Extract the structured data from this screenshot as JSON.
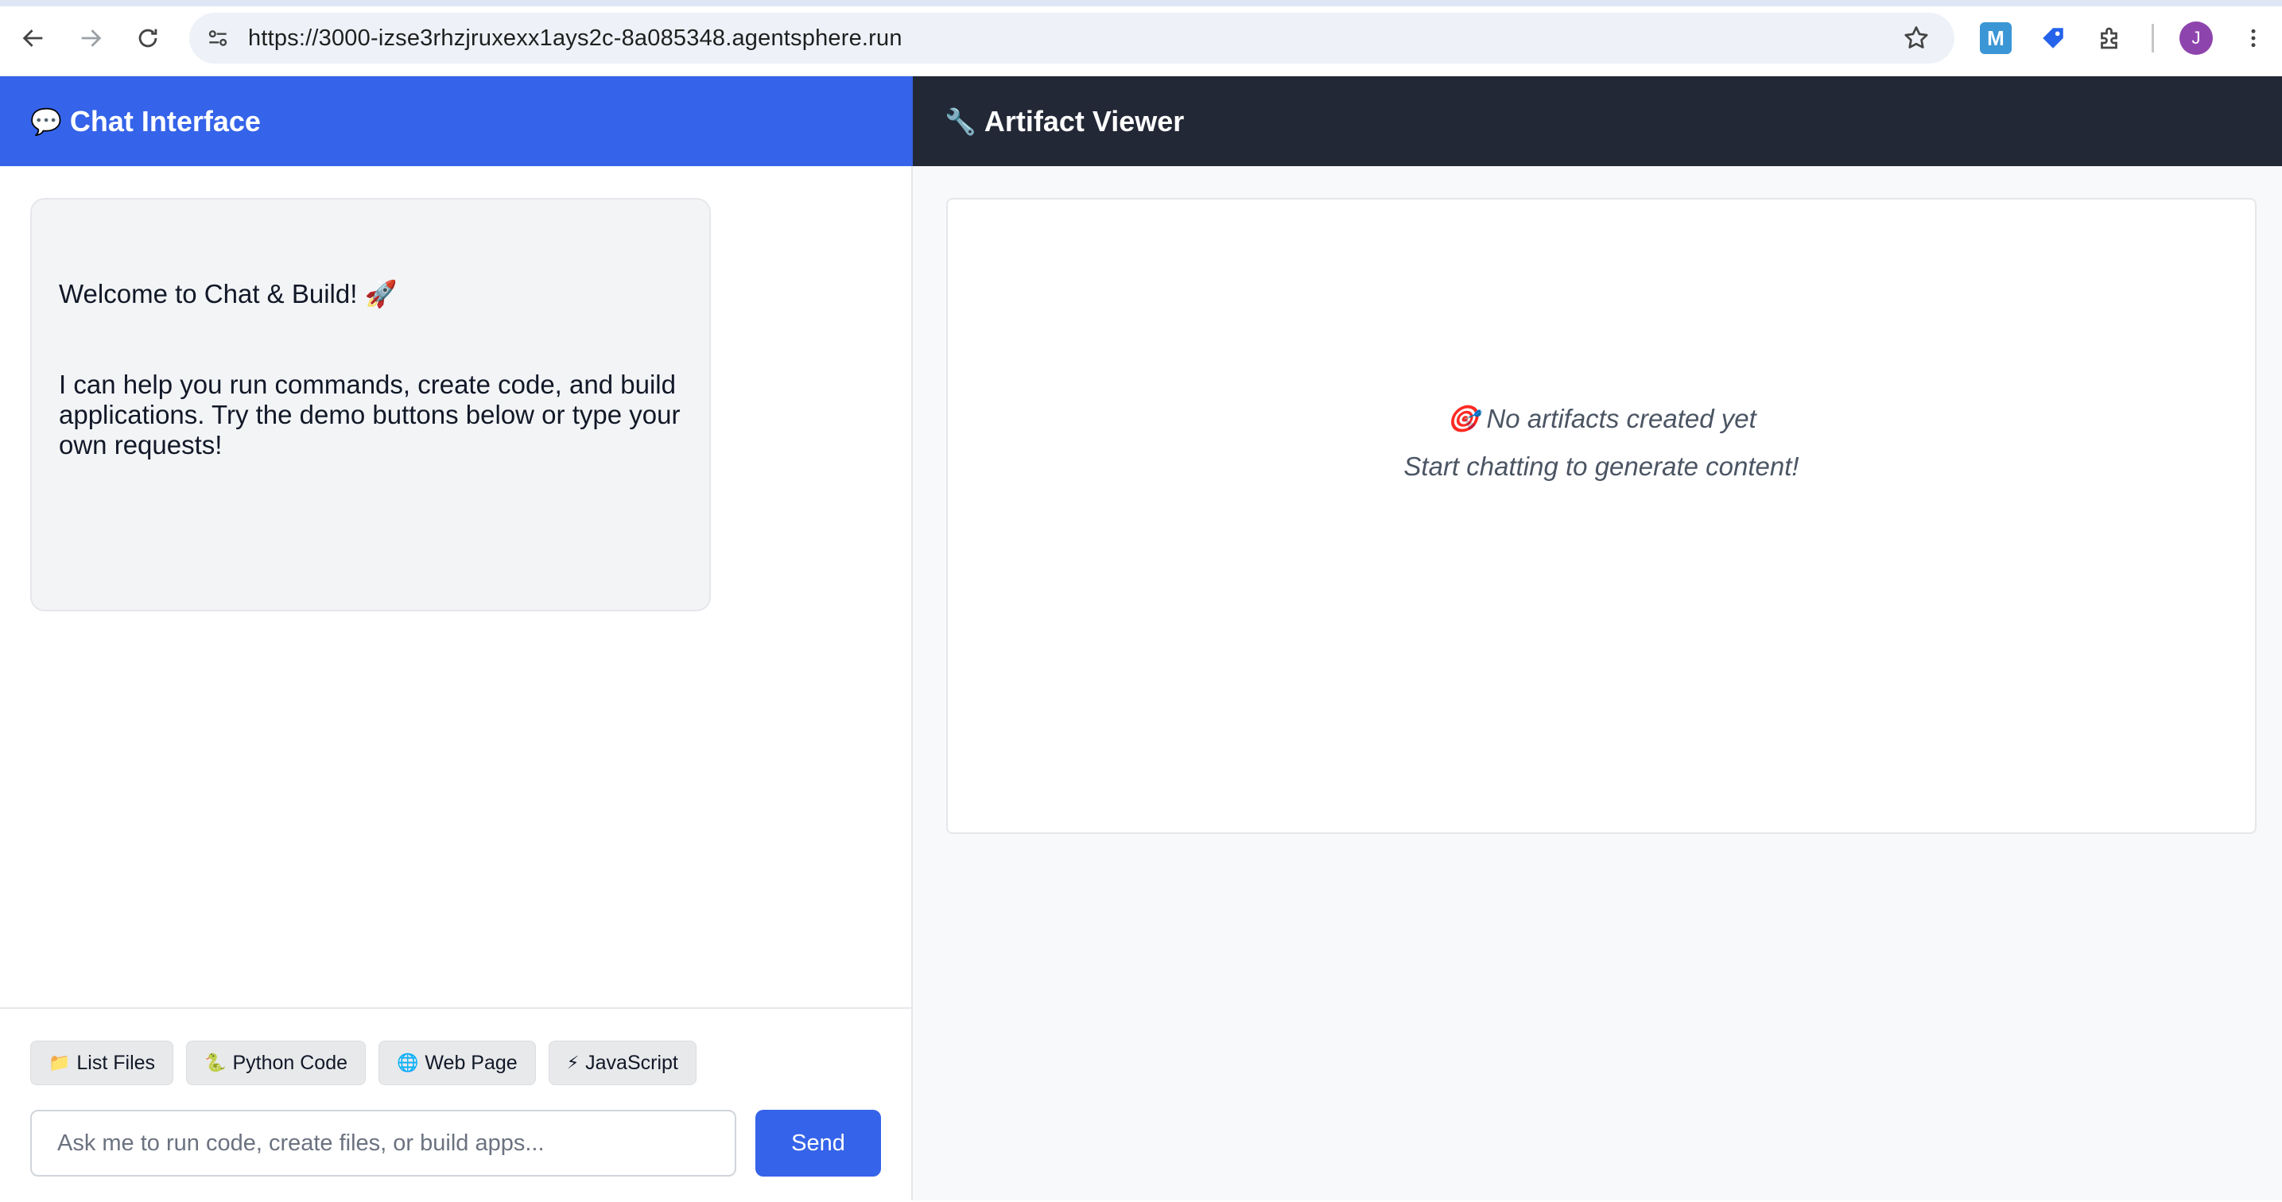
{
  "browser": {
    "url": "https://3000-izse3rhzjruxexx1ays2c-8a085348.agentsphere.run",
    "extension_m_label": "M",
    "avatar_initial": "J"
  },
  "chat": {
    "header_icon": "💬",
    "title": "Chat Interface",
    "welcome_title": "Welcome to Chat & Build! 🚀",
    "welcome_body": "I can help you run commands, create code, and build applications. Try the demo buttons below or type your own requests!",
    "demo_buttons": [
      {
        "icon": "📁",
        "label": "List Files"
      },
      {
        "icon": "🐍",
        "label": "Python Code"
      },
      {
        "icon": "🌐",
        "label": "Web Page"
      },
      {
        "icon": "⚡",
        "label": "JavaScript"
      }
    ],
    "input_placeholder": "Ask me to run code, create files, or build apps...",
    "send_label": "Send"
  },
  "artifacts": {
    "header_icon": "🔧",
    "title": "Artifact Viewer",
    "empty_icon": "🎯",
    "empty_title": "No artifacts created yet",
    "empty_subtitle": "Start chatting to generate content!"
  },
  "colors": {
    "chat_header_bg": "#3563e9",
    "artifact_header_bg": "#222835",
    "send_button_bg": "#3563e9",
    "avatar_bg": "#8e44ad"
  }
}
